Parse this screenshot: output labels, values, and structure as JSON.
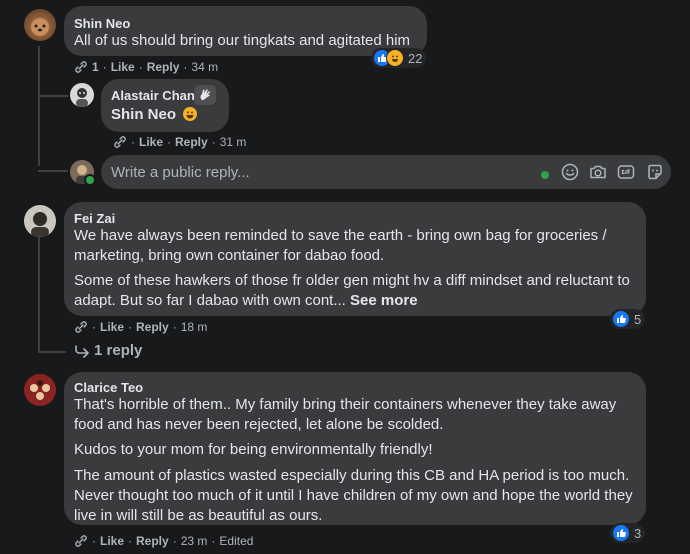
{
  "comments": [
    {
      "author": "Shin Neo",
      "text": "All of us should bring our tingkats and agitated him",
      "link_count": "1",
      "like": "Like",
      "reply": "Reply",
      "time": "34 m",
      "reaction_count": "22"
    },
    {
      "author": "Fei Zai",
      "para1": "We have always been reminded to save the earth - bring own bag for groceries / marketing, bring own container for dabao food.",
      "para2": "Some of these hawkers of those fr older gen might hv a diff mindset and reluctant to adapt. But so far I dabao with own cont...",
      "see_more": "See more",
      "like": "Like",
      "reply": "Reply",
      "time": "18 m",
      "reaction_count": "5",
      "replies_link": "1 reply"
    },
    {
      "author": "Clarice Teo",
      "para1": "That's horrible of them.. My family bring their containers whenever they take away food and has never been rejected, let alone be scolded.",
      "para2": "Kudos to your mom for being environmentally friendly!",
      "para3": "The amount of plastics wasted especially during this CB and HA period is too much. Never thought too much of it until I have children of my own and hope the world they live in will still be as beautiful as ours.",
      "like": "Like",
      "reply": "Reply",
      "time": "23 m",
      "edited": "Edited",
      "reaction_count": "3"
    }
  ],
  "reply": {
    "author": "Alastair Chan",
    "text": "Shin Neo",
    "like": "Like",
    "reply": "Reply",
    "time": "31 m"
  },
  "composer": {
    "placeholder": "Write a public reply..."
  },
  "colors": {
    "background": "#18191a",
    "bubble": "#3a3b3c",
    "text": "#e4e6eb",
    "secondary": "#b0b3b8",
    "like_blue": "#1877f2",
    "online_green": "#31a24c"
  },
  "icons": [
    "link-icon",
    "like-reaction-icon",
    "haha-reaction-icon",
    "wave-icon",
    "grinning-emoji",
    "reply-arrow-icon",
    "emoji-icon",
    "camera-icon",
    "gif-icon",
    "sticker-icon"
  ]
}
